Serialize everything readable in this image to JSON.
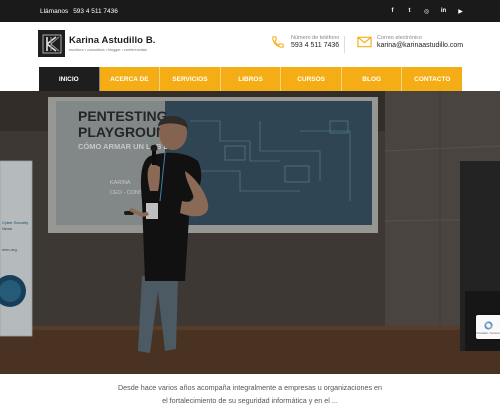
{
  "topbar": {
    "call_label": "Llámanos",
    "phone": "593 4 511 7436",
    "socials": [
      {
        "name": "facebook-icon",
        "glyph": "f"
      },
      {
        "name": "twitter-icon",
        "glyph": "t"
      },
      {
        "name": "instagram-icon",
        "glyph": "◎"
      },
      {
        "name": "linkedin-icon",
        "glyph": "in"
      },
      {
        "name": "youtube-icon",
        "glyph": "▶"
      }
    ]
  },
  "header": {
    "logo_name": "Karina Astudillo B.",
    "logo_tagline": "escritora • consultora • blogger • conferencista",
    "phone_label": "Número de teléfono",
    "phone_value": "593 4 511 7436",
    "email_label": "Correo electrónico",
    "email_value": "karina@karinaastudillo.com"
  },
  "nav": {
    "items": [
      "INICIO",
      "ACERCA DE",
      "SERVICIOS",
      "LIBROS",
      "CURSOS",
      "BLOG",
      "CONTACTO"
    ],
    "active_index": 0
  },
  "hero": {
    "slide_title_line1": "PENTESTING",
    "slide_title_line2": "PLAYGROUND",
    "slide_subtitle": "CÓMO ARMAR UN LAB DE",
    "slide_author": "KARINA",
    "slide_role": "CEO - CONSULT",
    "banner_text_1": "Cyber Security",
    "banner_text_2": "News",
    "banner_text_3": "men.org"
  },
  "recaptcha": {
    "label": "Privacidad - Términos"
  },
  "intro": {
    "line1": "Desde hace varios años acompaña integralmente a empresas u organizaciones en",
    "line2": "el fortalecimiento de su seguridad informática y en el ..."
  },
  "colors": {
    "accent": "#f5ad15",
    "dark": "#1e1e1e",
    "topbar": "#1a1a1a"
  }
}
